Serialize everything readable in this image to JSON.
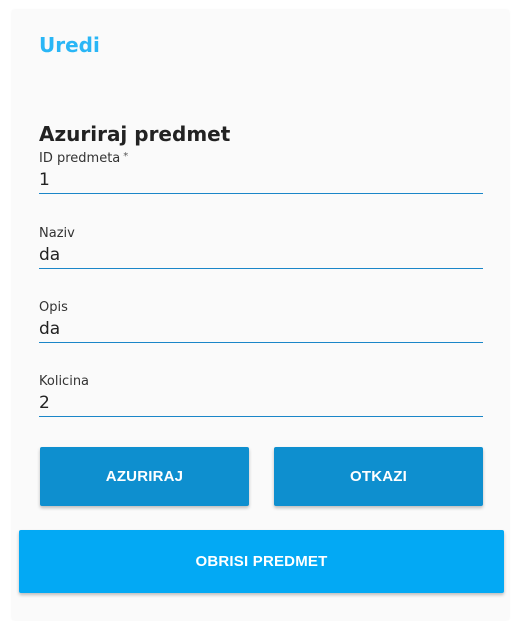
{
  "header": {
    "title": "Uredi"
  },
  "form": {
    "title": "Azuriraj predmet",
    "fields": [
      {
        "label": "ID predmeta",
        "required_mark": "*",
        "value": "1"
      },
      {
        "label": "Naziv",
        "value": "da"
      },
      {
        "label": "Opis",
        "value": "da"
      },
      {
        "label": "Kolicina",
        "value": "2"
      }
    ]
  },
  "buttons": {
    "update_label": "AZURIRAJ",
    "cancel_label": "OTKAZI",
    "delete_label": "OBRISI PREDMET"
  },
  "colors": {
    "accent_title": "#29b6f6",
    "primary_button": "#0e8fcf",
    "delete_button": "#03a9f4",
    "underline": "#1a86c8"
  }
}
